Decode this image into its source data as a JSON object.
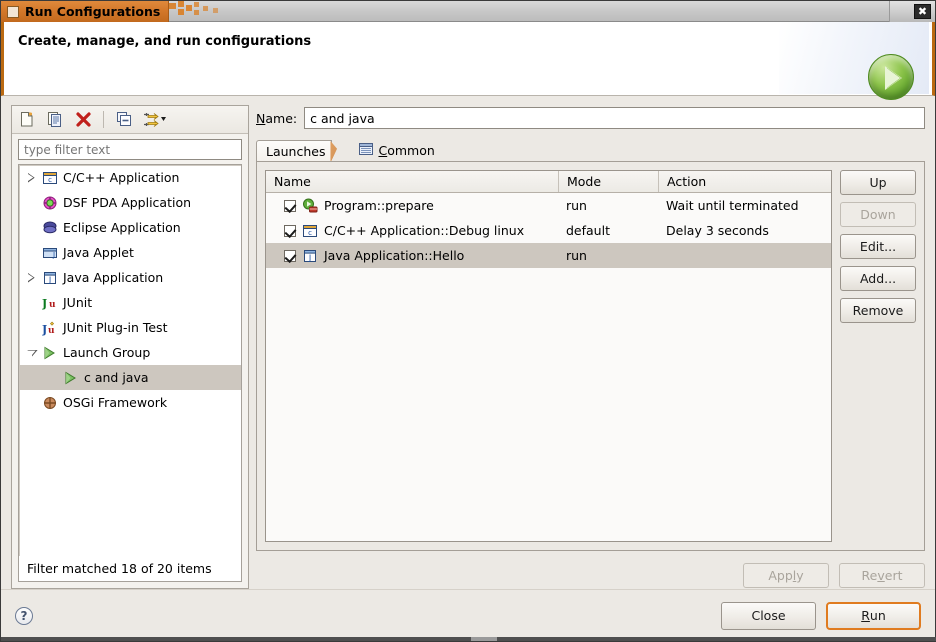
{
  "window": {
    "title": "Run Configurations",
    "close_label": "✖",
    "icon": "window-icon"
  },
  "banner": {
    "title": "Create, manage, and run configurations",
    "badge_icon": "run-play-badge-icon"
  },
  "left_panel": {
    "toolbar": [
      {
        "name": "new-launch-configuration-icon",
        "label": "New launch configuration"
      },
      {
        "name": "duplicate-launch-configuration-icon",
        "label": "Duplicate"
      },
      {
        "name": "delete-launch-configuration-icon",
        "label": "Delete"
      },
      {
        "name": "collapse-all-icon",
        "label": "Collapse All"
      },
      {
        "name": "filter-launch-configurations-icon",
        "label": "Filter"
      }
    ],
    "filter": {
      "placeholder": "type filter text",
      "value": ""
    },
    "tree": [
      {
        "label": "C/C++ Application",
        "icon": "c-application-icon",
        "arrow": "closed",
        "child": false,
        "selected": false
      },
      {
        "label": "DSF PDA Application",
        "icon": "dsf-pda-icon",
        "arrow": "none",
        "child": false,
        "selected": false
      },
      {
        "label": "Eclipse Application",
        "icon": "eclipse-application-icon",
        "arrow": "none",
        "child": false,
        "selected": false
      },
      {
        "label": "Java Applet",
        "icon": "java-applet-icon",
        "arrow": "none",
        "child": false,
        "selected": false
      },
      {
        "label": "Java Application",
        "icon": "java-application-icon",
        "arrow": "closed",
        "child": false,
        "selected": false
      },
      {
        "label": "JUnit",
        "icon": "junit-icon",
        "arrow": "none",
        "child": false,
        "selected": false
      },
      {
        "label": "JUnit Plug-in Test",
        "icon": "junit-plugin-icon",
        "arrow": "none",
        "child": false,
        "selected": false
      },
      {
        "label": "Launch Group",
        "icon": "launch-group-icon",
        "arrow": "open",
        "child": false,
        "selected": false
      },
      {
        "label": "c and java",
        "icon": "launch-group-icon",
        "arrow": "none",
        "child": true,
        "selected": true
      },
      {
        "label": "OSGi Framework",
        "icon": "osgi-framework-icon",
        "arrow": "none",
        "child": false,
        "selected": false
      }
    ],
    "filter_status": "Filter matched 18 of 20 items"
  },
  "right_panel": {
    "name_label": "Name:",
    "name_mnemonic": "N",
    "name_value": "c and java",
    "tabs": [
      {
        "label": "Launches",
        "active": true,
        "icon": ""
      },
      {
        "label": "Common",
        "active": false,
        "icon": "common-tab-icon",
        "mnemonic": "C"
      }
    ],
    "table": {
      "columns": [
        "Name",
        "Mode",
        "Action"
      ],
      "rows": [
        {
          "checked": true,
          "icon": "program-prepare-icon",
          "name": "Program::prepare",
          "mode": "run",
          "action": "Wait until terminated",
          "selected": false
        },
        {
          "checked": true,
          "icon": "c-application-icon",
          "name": "C/C++ Application::Debug linux",
          "mode": "default",
          "action": "Delay 3 seconds",
          "selected": false
        },
        {
          "checked": true,
          "icon": "java-application-icon",
          "name": "Java Application::Hello",
          "mode": "run",
          "action": "",
          "selected": true
        }
      ]
    },
    "side_buttons": [
      {
        "label": "Up",
        "enabled": true
      },
      {
        "label": "Down",
        "enabled": false
      },
      {
        "label": "Edit...",
        "enabled": true
      },
      {
        "label": "Add...",
        "enabled": true
      },
      {
        "label": "Remove",
        "enabled": true
      }
    ],
    "apply_button": {
      "label": "Apply",
      "mnemonic": "l",
      "enabled": false
    },
    "revert_button": {
      "label": "Revert",
      "mnemonic": "v",
      "enabled": false
    }
  },
  "footer": {
    "help_icon": "help-icon",
    "help_label": "?",
    "close_button": {
      "label": "Close",
      "enabled": true
    },
    "run_button": {
      "label": "Run",
      "mnemonic": "R",
      "enabled": true,
      "default": true
    }
  },
  "colors": {
    "title_accent": "#d4782a",
    "dialog_bg": "#ece9e4",
    "selection": "#cdc7bf",
    "default_button_border": "#e07b1f",
    "run_badge_green": "#8dc44b"
  }
}
